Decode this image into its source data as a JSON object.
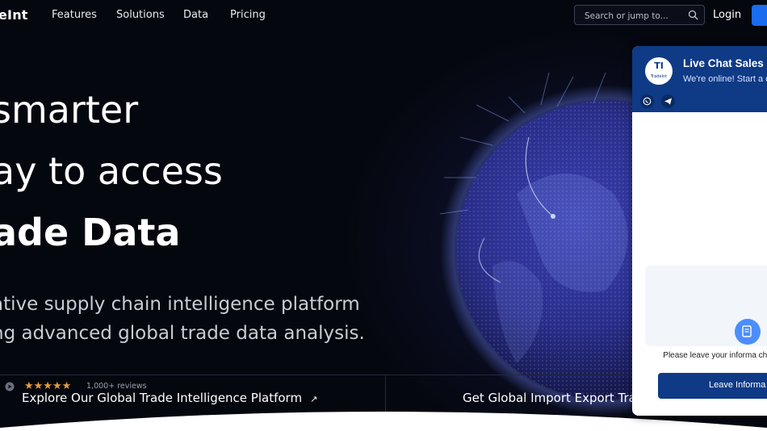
{
  "nav": {
    "logo": "eInt",
    "links": [
      "Features",
      "Solutions",
      "Data",
      "Pricing"
    ],
    "search_placeholder": "Search or jump to...",
    "login": "Login"
  },
  "hero": {
    "line1": "smarter",
    "line2": "ay to access",
    "line3": "ade  Data",
    "sub1": "ative supply chain intelligence platform",
    "sub2": "ng advanced global trade data analysis.",
    "rating_prefix": "o",
    "stars": "★★★★★",
    "reviews": "1,000+ reviews",
    "explore": "Explore Our Global Trade Intelligence Platform",
    "import": "Get Global Import Export Tra"
  },
  "chat": {
    "avatar_initials": "TI",
    "avatar_name": "TradeInt",
    "title": "Live Chat Sales",
    "status": "We're online! Start a c",
    "info_text": "Please leave your informa chatting",
    "leave_button": "Leave Informa"
  },
  "colors": {
    "background": "#05070f",
    "accent": "#1a6cf0",
    "chat_header": "#0e3a86",
    "stars": "#e59a3c"
  }
}
